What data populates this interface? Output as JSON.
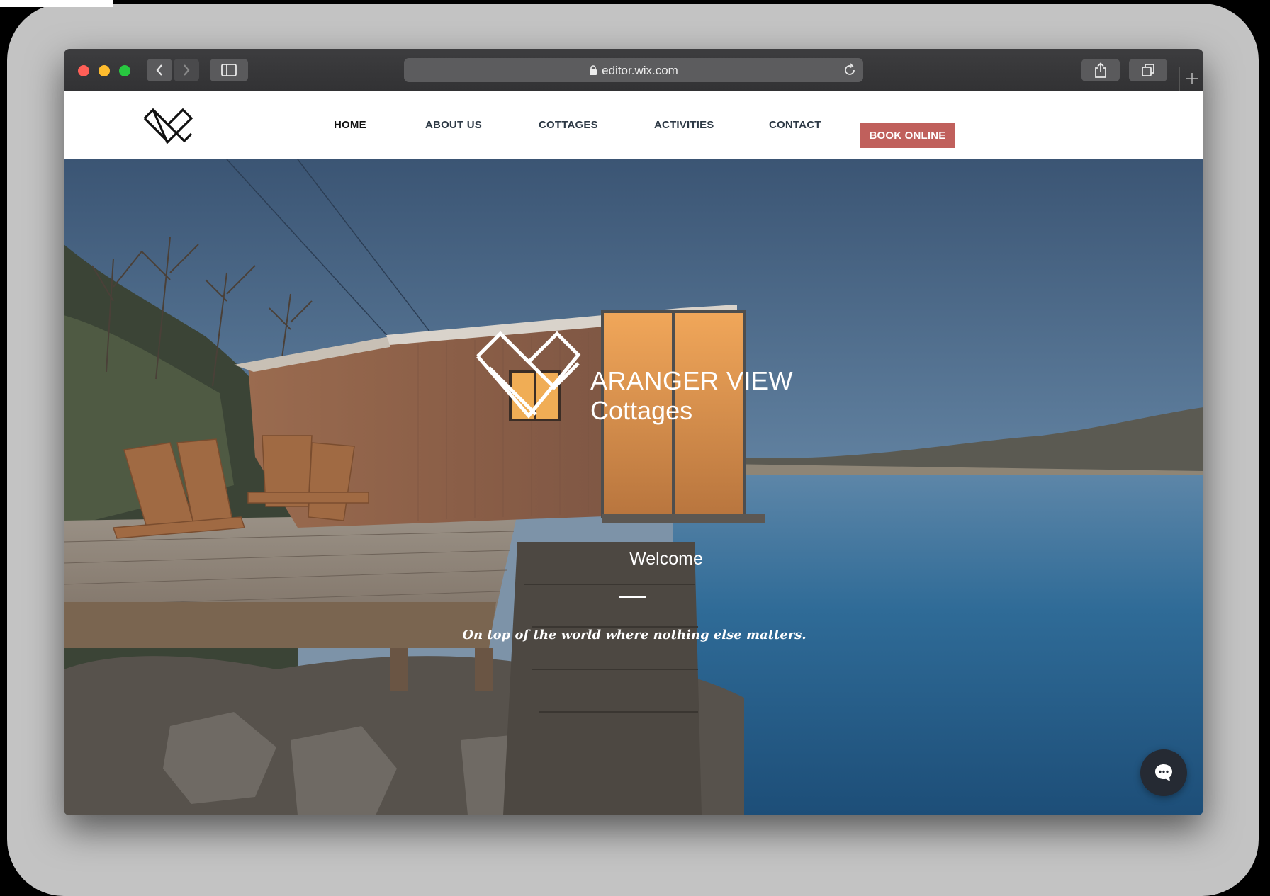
{
  "browser": {
    "url": "editor.wix.com"
  },
  "site": {
    "nav": [
      {
        "label": "HOME"
      },
      {
        "label": "ABOUT US"
      },
      {
        "label": "COTTAGES"
      },
      {
        "label": "ACTIVITIES"
      },
      {
        "label": "CONTACT"
      }
    ],
    "cta_label": "BOOK ONLINE",
    "cta_color": "#c0605c"
  },
  "hero": {
    "brand_line1": "ARANGER VIEW",
    "brand_line2": "Cottages",
    "welcome": "Welcome",
    "tagline": "On top of the world where nothing else matters."
  },
  "icons": [
    "back-icon",
    "forward-icon",
    "sidebar-icon",
    "lock-icon",
    "reload-icon",
    "share-icon",
    "tabs-icon",
    "plus-icon",
    "site-logo-icon",
    "chat-icon"
  ]
}
